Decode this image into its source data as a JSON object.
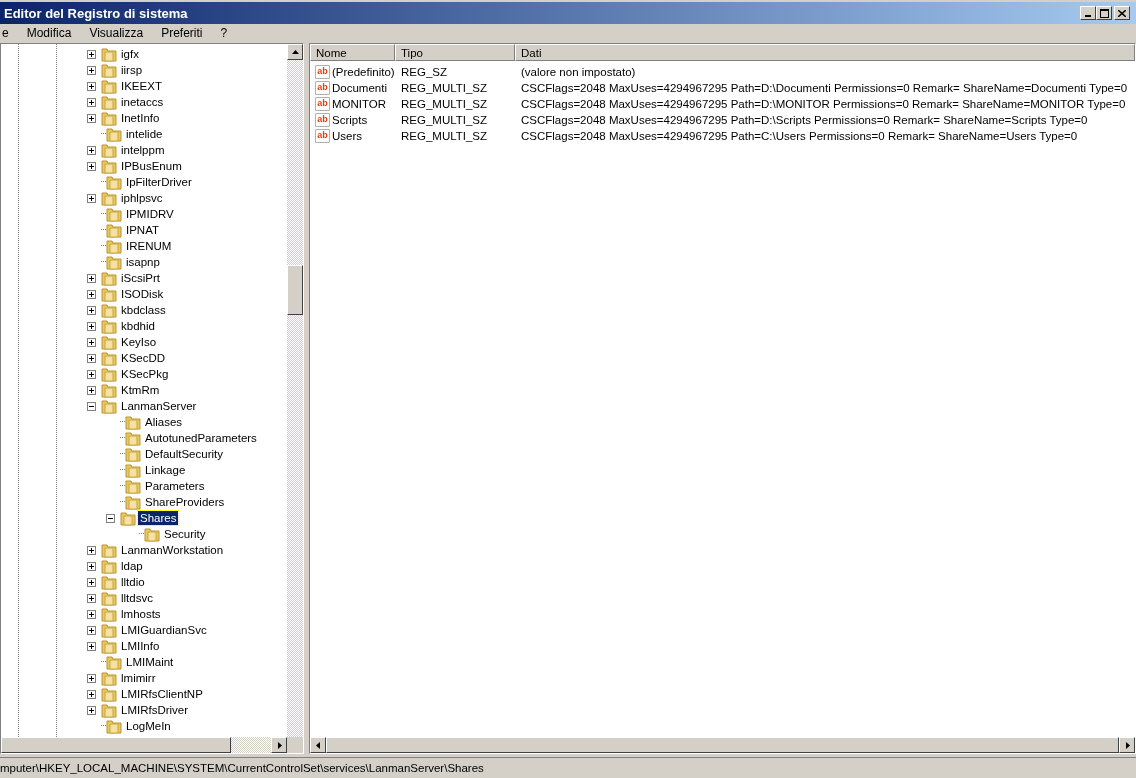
{
  "window": {
    "title": "Editor del Registro di sistema"
  },
  "menu": [
    "e",
    "Modifica",
    "Visualizza",
    "Preferiti",
    "?"
  ],
  "tree": [
    {
      "label": "igfx",
      "kind": "branch",
      "expanded": false,
      "selected": false
    },
    {
      "label": "iirsp",
      "kind": "branch",
      "expanded": false,
      "selected": false
    },
    {
      "label": "IKEEXT",
      "kind": "branch",
      "expanded": false,
      "selected": false
    },
    {
      "label": "inetaccs",
      "kind": "branch",
      "expanded": false,
      "selected": false
    },
    {
      "label": "InetInfo",
      "kind": "branch",
      "expanded": false,
      "selected": false
    },
    {
      "label": "intelide",
      "kind": "leaf",
      "selected": false
    },
    {
      "label": "intelppm",
      "kind": "branch",
      "expanded": false,
      "selected": false
    },
    {
      "label": "IPBusEnum",
      "kind": "branch",
      "expanded": false,
      "selected": false
    },
    {
      "label": "IpFilterDriver",
      "kind": "leaf",
      "selected": false
    },
    {
      "label": "iphlpsvc",
      "kind": "branch",
      "expanded": false,
      "selected": false
    },
    {
      "label": "IPMIDRV",
      "kind": "leaf",
      "selected": false
    },
    {
      "label": "IPNAT",
      "kind": "leaf",
      "selected": false
    },
    {
      "label": "IRENUM",
      "kind": "leaf",
      "selected": false
    },
    {
      "label": "isapnp",
      "kind": "leaf",
      "selected": false
    },
    {
      "label": "iScsiPrt",
      "kind": "branch",
      "expanded": false,
      "selected": false
    },
    {
      "label": "ISODisk",
      "kind": "branch",
      "expanded": false,
      "selected": false
    },
    {
      "label": "kbdclass",
      "kind": "branch",
      "expanded": false,
      "selected": false
    },
    {
      "label": "kbdhid",
      "kind": "branch",
      "expanded": false,
      "selected": false
    },
    {
      "label": "KeyIso",
      "kind": "branch",
      "expanded": false,
      "selected": false
    },
    {
      "label": "KSecDD",
      "kind": "branch",
      "expanded": false,
      "selected": false
    },
    {
      "label": "KSecPkg",
      "kind": "branch",
      "expanded": false,
      "selected": false
    },
    {
      "label": "KtmRm",
      "kind": "branch",
      "expanded": false,
      "selected": false
    },
    {
      "label": "LanmanServer",
      "kind": "branch",
      "expanded": true,
      "selected": false,
      "children": [
        {
          "label": "Aliases",
          "kind": "leaf",
          "selected": false
        },
        {
          "label": "AutotunedParameters",
          "kind": "leaf",
          "selected": false
        },
        {
          "label": "DefaultSecurity",
          "kind": "leaf",
          "selected": false
        },
        {
          "label": "Linkage",
          "kind": "leaf",
          "selected": false
        },
        {
          "label": "Parameters",
          "kind": "leaf",
          "selected": false
        },
        {
          "label": "ShareProviders",
          "kind": "leaf",
          "selected": false
        },
        {
          "label": "Shares",
          "kind": "branch",
          "expanded": true,
          "selected": true,
          "children": [
            {
              "label": "Security",
              "kind": "leaf",
              "selected": false
            }
          ]
        }
      ]
    },
    {
      "label": "LanmanWorkstation",
      "kind": "branch",
      "expanded": false,
      "selected": false
    },
    {
      "label": "ldap",
      "kind": "branch",
      "expanded": false,
      "selected": false
    },
    {
      "label": "lltdio",
      "kind": "branch",
      "expanded": false,
      "selected": false
    },
    {
      "label": "lltdsvc",
      "kind": "branch",
      "expanded": false,
      "selected": false
    },
    {
      "label": "lmhosts",
      "kind": "branch",
      "expanded": false,
      "selected": false
    },
    {
      "label": "LMIGuardianSvc",
      "kind": "branch",
      "expanded": false,
      "selected": false
    },
    {
      "label": "LMIInfo",
      "kind": "branch",
      "expanded": false,
      "selected": false
    },
    {
      "label": "LMIMaint",
      "kind": "leaf",
      "selected": false
    },
    {
      "label": "lmimirr",
      "kind": "branch",
      "expanded": false,
      "selected": false
    },
    {
      "label": "LMIRfsClientNP",
      "kind": "branch",
      "expanded": false,
      "selected": false
    },
    {
      "label": "LMIRfsDriver",
      "kind": "branch",
      "expanded": false,
      "selected": false
    },
    {
      "label": "LogMeIn",
      "kind": "leaf",
      "selected": false
    }
  ],
  "values": {
    "columns": [
      "Nome",
      "Tipo",
      "Dati"
    ],
    "rows": [
      {
        "icon_label": "ab",
        "name": "(Predefinito)",
        "type": "REG_SZ",
        "data": "(valore non impostato)"
      },
      {
        "icon_label": "ab",
        "name": "Documenti",
        "type": "REG_MULTI_SZ",
        "data": "CSCFlags=2048 MaxUses=4294967295 Path=D:\\Documenti Permissions=0 Remark= ShareName=Documenti Type=0"
      },
      {
        "icon_label": "ab",
        "name": "MONITOR",
        "type": "REG_MULTI_SZ",
        "data": "CSCFlags=2048 MaxUses=4294967295 Path=D:\\MONITOR Permissions=0 Remark= ShareName=MONITOR Type=0"
      },
      {
        "icon_label": "ab",
        "name": "Scripts",
        "type": "REG_MULTI_SZ",
        "data": "CSCFlags=2048 MaxUses=4294967295 Path=D:\\Scripts Permissions=0 Remark= ShareName=Scripts Type=0"
      },
      {
        "icon_label": "ab",
        "name": "Users",
        "type": "REG_MULTI_SZ",
        "data": "CSCFlags=2048 MaxUses=4294967295 Path=C:\\Users Permissions=0 Remark= ShareName=Users Type=0"
      }
    ]
  },
  "status_bar": "mputer\\HKEY_LOCAL_MACHINE\\SYSTEM\\CurrentControlSet\\services\\LanmanServer\\Shares"
}
